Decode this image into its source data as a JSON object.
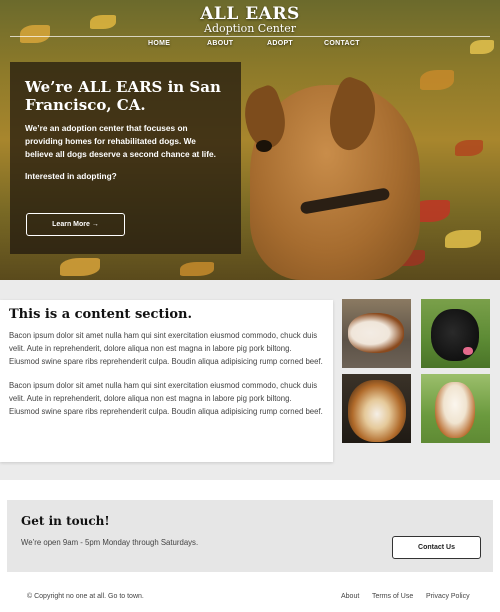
{
  "header": {
    "brand_line1": "ALL EARS",
    "brand_line2": "Adoption Center",
    "nav": [
      "HOME",
      "ABOUT",
      "ADOPT",
      "CONTACT"
    ]
  },
  "hero": {
    "title": "We’re ALL EARS in San Francisco, CA.",
    "description": "We’re an adoption center that focuses on providing homes for rehabilitated dogs. We believe all dogs deserve a second chance at life.",
    "question": "Interested in adopting?",
    "cta_label": "Learn More →"
  },
  "content": {
    "title": "This is a content section.",
    "paragraphs": [
      "Bacon ipsum dolor sit amet nulla ham qui sint exercitation eiusmod commodo, chuck duis velit. Aute in reprehenderit, dolore aliqua non est magna in labore pig pork biltong. Eiusmod swine spare ribs reprehenderit culpa. Boudin aliqua adipisicing rump corned beef.",
      "Bacon ipsum dolor sit amet nulla ham qui sint exercitation eiusmod commodo, chuck duis velit. Aute in reprehenderit, dolore aliqua non est magna in labore pig pork biltong. Eiusmod swine spare ribs reprehenderit culpa. Boudin aliqua adipisicing rump corned beef."
    ]
  },
  "contact": {
    "title": "Get in touch!",
    "hours": "We’re open 9am - 5pm Monday through Saturdays.",
    "button_label": "Contact Us"
  },
  "footer": {
    "copyright": "© Copyright no one at all. Go to town.",
    "links": [
      "About",
      "Terms of Use",
      "Privacy Policy"
    ]
  }
}
